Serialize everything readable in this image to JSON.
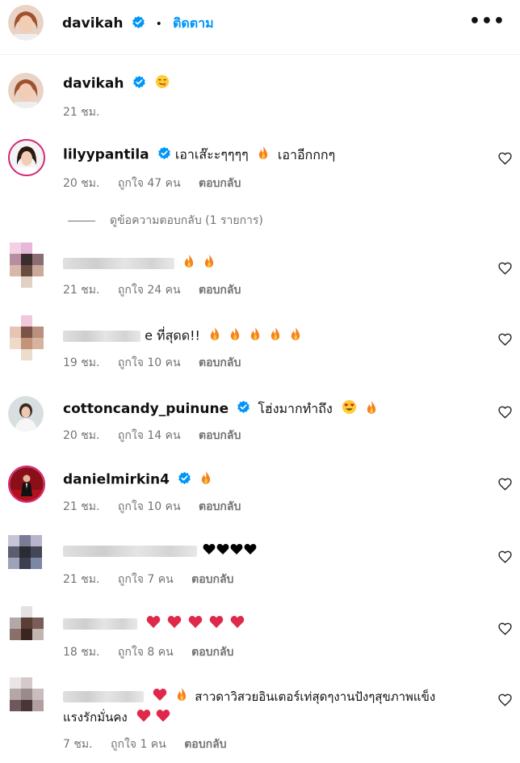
{
  "header": {
    "username": "davikah",
    "separator": "•",
    "follow_label": "ติดตาม",
    "more_label": "•••"
  },
  "caption": {
    "username": "davikah",
    "time": "21 ชม."
  },
  "comments": [
    {
      "username": "lilyypantila",
      "verified": true,
      "text": "เอาเส๊ะะๆๆๆๆ",
      "text2": "เอาอีกกกๆ",
      "time": "20 ชม.",
      "likes": "ถูกใจ 47 คน",
      "reply": "ตอบกลับ"
    },
    {
      "username": "",
      "text": "",
      "time": "21 ชม.",
      "likes": "ถูกใจ 24 คน",
      "reply": "ตอบกลับ"
    },
    {
      "username": "",
      "text": "e ที่สุดด!!",
      "time": "19 ชม.",
      "likes": "ถูกใจ 10 คน",
      "reply": "ตอบกลับ"
    },
    {
      "username": "cottoncandy_puinune",
      "verified": true,
      "text": "โฮ่งมากทำถึง",
      "time": "20 ชม.",
      "likes": "ถูกใจ 14 คน",
      "reply": "ตอบกลับ"
    },
    {
      "username": "danielmirkin4",
      "verified": true,
      "text": "",
      "time": "21 ชม.",
      "likes": "ถูกใจ 10 คน",
      "reply": "ตอบกลับ"
    },
    {
      "username": "",
      "text": "",
      "time": "21 ชม.",
      "likes": "ถูกใจ 7 คน",
      "reply": "ตอบกลับ"
    },
    {
      "username": "",
      "text": "",
      "time": "18 ชม.",
      "likes": "ถูกใจ 8 คน",
      "reply": "ตอบกลับ"
    },
    {
      "username": "",
      "text": "สาวดาวิสวยอินเตอร์เท่สุดๆงานปังๆสุขภาพแข็ง",
      "text2": "แรงรักมั่นคง",
      "time": "7 ชม.",
      "likes": "ถูกใจ 1 คน",
      "reply": "ตอบกลับ"
    }
  ],
  "view_replies": "ดูข้อความตอบกลับ (1 รายการ)",
  "colors": {
    "accent": "#0095f6",
    "verified": "#0095f6",
    "secondary_text": "#737373"
  }
}
